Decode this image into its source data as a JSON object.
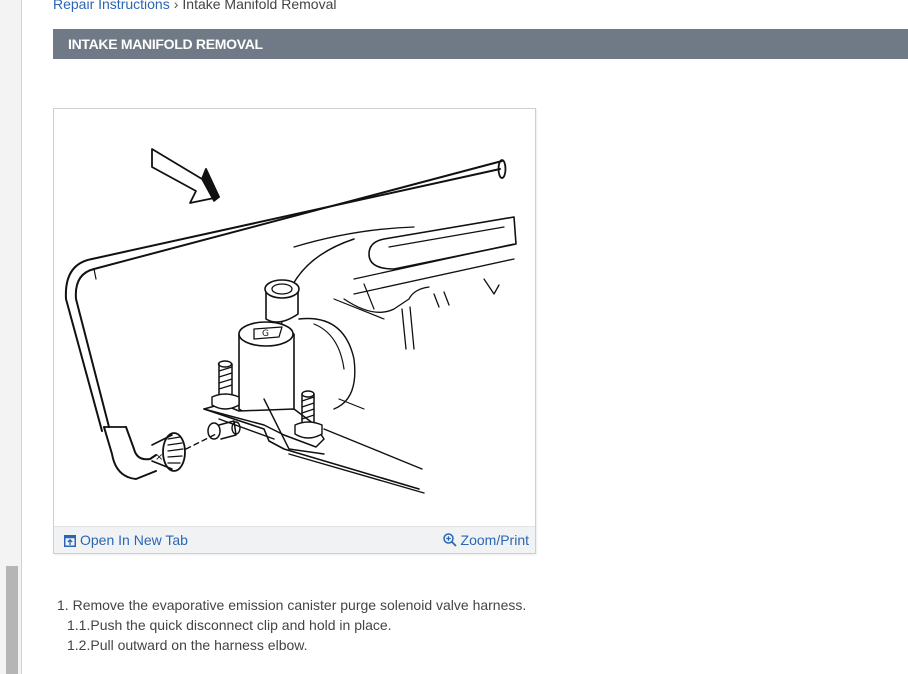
{
  "breadcrumb": {
    "parent": "Repair Instructions",
    "separator": "›",
    "current": "Intake Manifold Removal"
  },
  "header": {
    "title": "INTAKE MANIFOLD REMOVAL"
  },
  "figure": {
    "open_label": "Open In New Tab",
    "zoom_label": "Zoom/Print"
  },
  "steps": [
    {
      "number": "1.",
      "text": "Remove the evaporative emission canister purge solenoid valve harness."
    },
    {
      "number": "1.1.",
      "text": "Push the quick disconnect clip and hold in place."
    },
    {
      "number": "1.2.",
      "text": "Pull outward on the harness elbow."
    }
  ],
  "colors": {
    "header_bg": "#6f7a86",
    "link": "#2a66b5",
    "footer_bg": "#f1f2f4"
  },
  "icons": {
    "open_tab": "open-in-new-tab-icon",
    "zoom": "zoom-in-icon"
  }
}
